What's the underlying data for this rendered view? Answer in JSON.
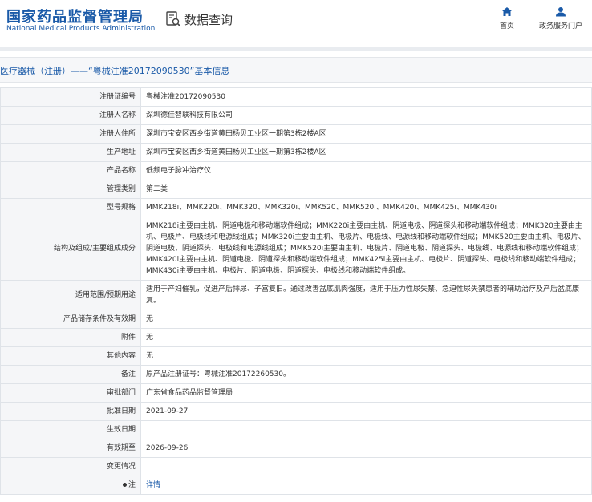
{
  "header": {
    "logo_cn": "国家药品监督管理局",
    "logo_en": "National Medical Products Administration",
    "query_title": "数据查询",
    "nav": [
      {
        "label": "首页",
        "icon": "home-icon"
      },
      {
        "label": "政务服务门户",
        "icon": "user-icon"
      }
    ]
  },
  "page_title": "医疗器械（注册）——“粤械注准20172090530”基本信息",
  "colors": {
    "brand": "#1a5aa8",
    "label_bg": "#f5f6f8",
    "border": "#dfe3e8"
  },
  "rows": [
    {
      "label": "注册证编号",
      "value": "粤械注准20172090530"
    },
    {
      "label": "注册人名称",
      "value": "深圳德佳智联科技有限公司"
    },
    {
      "label": "注册人住所",
      "value": "深圳市宝安区西乡街道黄田杨贝工业区一期第3栋2楼A区"
    },
    {
      "label": "生产地址",
      "value": "深圳市宝安区西乡街道黄田杨贝工业区一期第3栋2楼A区"
    },
    {
      "label": "产品名称",
      "value": "低频电子脉冲治疗仪"
    },
    {
      "label": "管理类别",
      "value": "第二类"
    },
    {
      "label": "型号规格",
      "value": "MMK218i、MMK220i、MMK320、MMK320i、MMK520、MMK520i、MMK420i、MMK425i、MMK430i"
    },
    {
      "label": "结构及组成/主要组成成分",
      "value": "MMK218i主要由主机、阴道电极和移动端软件组成；MMK220i主要由主机、阴道电极、阴道探头和移动端软件组成；MMK320主要由主机、电极片、电极线和电源线组成；MMK320i主要由主机、电极片、电极线、电源线和移动端软件组成；MMK520主要由主机、电极片、阴道电极、阴道探头、电极线和电源线组成；MMK520i主要由主机、电极片、阴道电极、阴道探头、电极线、电源线和移动端软件组成；MMK420i主要由主机、阴道电极、阴道探头和移动端软件组成；MMK425i主要由主机、电极片、阴道探头、电极线和移动端软件组成；MMK430i主要由主机、电极片、阴道电极、阴道探头、电极线和移动端软件组成。"
    },
    {
      "label": "适用范围/预期用途",
      "value": "适用于产妇催乳，促进产后排尿、子宫复旧。通过改善盆底肌肉强度，适用于压力性尿失禁、急迫性尿失禁患者的辅助治疗及产后盆底康复。"
    },
    {
      "label": "产品储存条件及有效期",
      "value": "无"
    },
    {
      "label": "附件",
      "value": "无"
    },
    {
      "label": "其他内容",
      "value": "无"
    },
    {
      "label": "备注",
      "value": "原产品注册证号：粤械注准20172260530。"
    },
    {
      "label": "审批部门",
      "value": "广东省食品药品监督管理局"
    },
    {
      "label": "批准日期",
      "value": "2021-09-27"
    },
    {
      "label": "生效日期",
      "value": ""
    },
    {
      "label": "有效期至",
      "value": "2026-09-26"
    },
    {
      "label": "变更情况",
      "value": ""
    }
  ],
  "note_row": {
    "label": "注",
    "value": "详情"
  }
}
